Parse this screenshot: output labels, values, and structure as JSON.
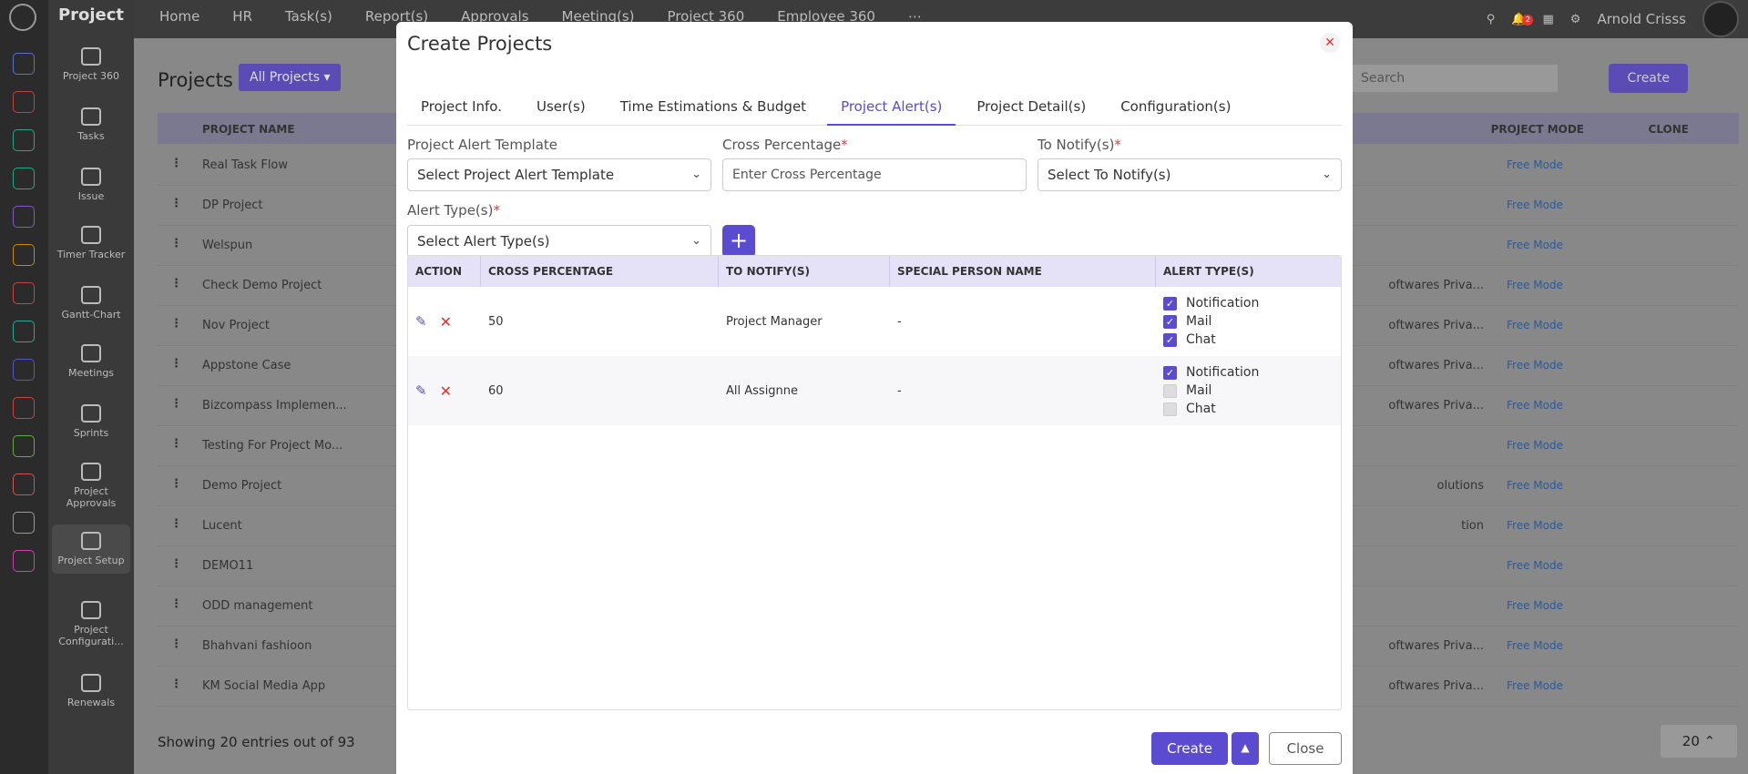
{
  "app": {
    "title": "Project",
    "sidebar": [
      "Project 360",
      "Tasks",
      "Issue",
      "Timer Tracker",
      "Gantt-Chart",
      "Meetings",
      "Sprints",
      "Project Approvals",
      "Project Setup",
      "Project Configurati...",
      "Renewals"
    ]
  },
  "topnav": [
    "Home",
    "HR",
    "Task(s)",
    "Report(s)",
    "Approvals",
    "Meeting(s)",
    "Project 360",
    "Employee 360"
  ],
  "user": {
    "name": "Arnold Crisss",
    "notifications": "2"
  },
  "page": {
    "title": "Projects",
    "filter": "All Projects",
    "search_placeholder": "Search",
    "create_label": "Create",
    "columns": [
      "PROJECT NAME",
      "PROJECT MODE",
      "CLONE"
    ],
    "rows": [
      {
        "name": "Real Task Flow",
        "org": "",
        "mode": "Free Mode"
      },
      {
        "name": "DP Project",
        "org": "",
        "mode": "Free Mode"
      },
      {
        "name": "Welspun",
        "org": "",
        "mode": "Free Mode"
      },
      {
        "name": "Check Demo Project",
        "org": "oftwares Priva...",
        "mode": "Free Mode"
      },
      {
        "name": "Nov Project",
        "org": "oftwares Priva...",
        "mode": "Free Mode"
      },
      {
        "name": "Appstone Case",
        "org": "oftwares Priva...",
        "mode": "Free Mode"
      },
      {
        "name": "Bizcompass Implemen...",
        "org": "oftwares Priva...",
        "mode": "Free Mode"
      },
      {
        "name": "Testing For Project Mo...",
        "org": "",
        "mode": "Free Mode"
      },
      {
        "name": "Demo Project",
        "org": "olutions",
        "mode": "Free Mode"
      },
      {
        "name": "Lucent",
        "org": "tion",
        "mode": "Free Mode"
      },
      {
        "name": "DEMO11",
        "org": "",
        "mode": "Free Mode"
      },
      {
        "name": "ODD management",
        "org": "",
        "mode": "Free Mode"
      },
      {
        "name": "Bhahvani fashioon",
        "org": "oftwares Priva...",
        "mode": "Free Mode"
      },
      {
        "name": "KM Social Media App",
        "org": "oftwares Priva...",
        "mode": "Free Mode"
      }
    ],
    "footer": "Showing 20 entries out of 93",
    "page_size": "20"
  },
  "modal": {
    "title": "Create Projects",
    "tabs": [
      "Project Info.",
      "User(s)",
      "Time Estimations & Budget",
      "Project Alert(s)",
      "Project Detail(s)",
      "Configuration(s)"
    ],
    "active_tab": "Project Alert(s)",
    "fields": {
      "template_label": "Project Alert Template",
      "template_value": "Select Project Alert Template",
      "cross_label": "Cross Percentage",
      "cross_placeholder": "Enter Cross Percentage",
      "notify_label": "To Notify(s)",
      "notify_value": "Select To Notify(s)",
      "alert_label": "Alert Type(s)",
      "alert_value": "Select Alert Type(s)"
    },
    "grid": {
      "columns": [
        "ACTION",
        "CROSS PERCENTAGE",
        "TO NOTIFY(S)",
        "SPECIAL PERSON NAME",
        "ALERT TYPE(S)"
      ],
      "rows": [
        {
          "cross": "50",
          "notify": "Project Manager",
          "special": "-",
          "alerts": [
            {
              "label": "Notification",
              "checked": true
            },
            {
              "label": "Mail",
              "checked": true
            },
            {
              "label": "Chat",
              "checked": true
            }
          ]
        },
        {
          "cross": "60",
          "notify": "All Assignne",
          "special": "-",
          "alerts": [
            {
              "label": "Notification",
              "checked": true
            },
            {
              "label": "Mail",
              "checked": false
            },
            {
              "label": "Chat",
              "checked": false
            }
          ]
        }
      ]
    },
    "buttons": {
      "create": "Create",
      "close": "Close"
    }
  }
}
